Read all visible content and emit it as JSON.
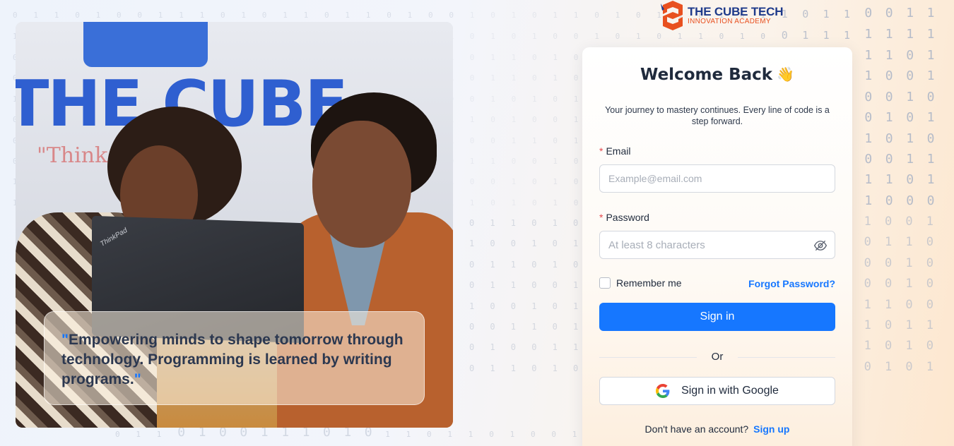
{
  "brand": {
    "title": "THE CUBE TECH",
    "subtitle": "INNOVATION ACADEMY",
    "accent_color": "#e8501f",
    "title_color": "#1e3a8a"
  },
  "hero": {
    "sign_text": "THE CUBE",
    "sign_tagline": "\"Think",
    "laptop_brand": "ThinkPad",
    "quote_open": "\"",
    "quote": "Empowering minds to shape tomorrow through technology. Programming is learned by writing programs.",
    "quote_close": "\""
  },
  "login": {
    "title": "Welcome Back",
    "title_icon": "waving-hand-icon",
    "subtitle": "Your journey to mastery continues. Every line of code is a step forward.",
    "email_label": "Email",
    "email_placeholder": "Example@email.com",
    "email_value": "",
    "password_label": "Password",
    "password_placeholder": "At least 8 characters",
    "password_value": "",
    "required_marker": "*",
    "remember_label": "Remember me",
    "remember_checked": false,
    "forgot_label": "Forgot Password?",
    "signin_label": "Sign in",
    "or_label": "Or",
    "google_label": "Sign in with Google",
    "signup_prompt": "Don't have an account?",
    "signup_label": "Sign up",
    "primary_color": "#1677ff"
  },
  "background": {
    "pattern": "binary-digits",
    "rows": [
      "0 1 1 0 1 0 0 1 1 1 0 1 0 1 1 0 1 1 0 1 0 0 1 0 1 0 1 1 0 1 0 1 0 0 1 0 1 1 0 1 1 0 0 1 1 0",
      "1 0 0 1 0 1 1 0 0 0 1 0 1 0 0 1 0 0 1 0 1 1 0 1 0 1 0 0 1 0 1 0 1 1 0 1 0 0 1 1 1 1 1 1 1 0",
      "0 1 1 0 1 0 1 1 0 0 1 0 1 1 0 1 0 1 1 0 0 1 0 1 1 0 1 0 0 1 1 0 1 1 1 0 0 1 1 0 1 1 1 0 1 0",
      "0 1 1 0 0 1 0 1 1 0 1 0 0 1 1 0 1 0 1 0 0 1 0 1 1 0 1 0 0 1 1 0 1 1 1 0 0 1 1 0 1 1 0 0 1 0",
      "1 0 0 1 0 1 1 0 1 0 0 1 1 0 1 0 0 1 0 1 1 0 0 1 0 1 0 1 1 0 1 0 0 0 1 1 1 0 1 1 1 0 0 1 0 0",
      "0 0 1 1 0 1 0 0 1 1 0 1 0 1 0 0 1 1 0 1 0 1 1 0 1 0 0 1 1 0 1 0 1 1 0 0 1 0 1 1 0 0 1 0 1 0",
      "0 1 0 0 1 1 0 1 0 0 1 1 0 1 0 1 1 0 0 1 0 1 0 0 1 1 0 1 0 0 1 1 0 0 1 0 1 1 0 0 1 1 0 1 0 0",
      "0 1 1 0 1 0 1 0 0 1 1 0 1 0 1 0 0 1 1 0 1 0 1 1 0 0 1 0 1 1 0 0 1 0 1 0 0 1 1 0 1 0 0 1 1 0",
      "1 0 0 1 0 1 1 0 1 0 0 1 1 0 1 1 0 0 1 0 1 1 0 0 1 0 1 0 1 1 0 0 1 0 1 1 0 0 1 0 1 1 1 0 1 0",
      "1 1 0 0 1 0 1 1 0 1 0 0 1 0 0 1 1 0 1 0 0 1 1 0 1 0 1 0 0 1 1 0 1 0 0 1 1 0 1 0 0 1 0 0 0 0"
    ]
  }
}
